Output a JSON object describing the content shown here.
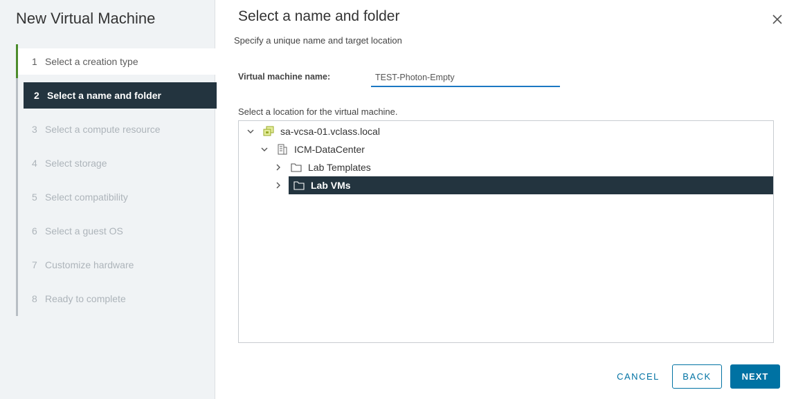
{
  "wizard": {
    "title": "New Virtual Machine",
    "steps": [
      {
        "num": "1",
        "label": "Select a creation type",
        "state": "completed"
      },
      {
        "num": "2",
        "label": "Select a name and folder",
        "state": "active"
      },
      {
        "num": "3",
        "label": "Select a compute resource",
        "state": "disabled"
      },
      {
        "num": "4",
        "label": "Select storage",
        "state": "disabled"
      },
      {
        "num": "5",
        "label": "Select compatibility",
        "state": "disabled"
      },
      {
        "num": "6",
        "label": "Select a guest OS",
        "state": "disabled"
      },
      {
        "num": "7",
        "label": "Customize hardware",
        "state": "disabled"
      },
      {
        "num": "8",
        "label": "Ready to complete",
        "state": "disabled"
      }
    ]
  },
  "page": {
    "title": "Select a name and folder",
    "subtitle": "Specify a unique name and target location",
    "close_icon": "close-icon"
  },
  "form": {
    "name_label": "Virtual machine name:",
    "name_value": "TEST-Photon-Empty",
    "location_label": "Select a location for the virtual machine."
  },
  "tree": {
    "items": [
      {
        "label": "sa-vcsa-01.vclass.local",
        "icon": "vcenter-icon",
        "expanded": true,
        "selected": false
      },
      {
        "label": "ICM-DataCenter",
        "icon": "datacenter-icon",
        "expanded": true,
        "selected": false
      },
      {
        "label": "Lab Templates",
        "icon": "folder-icon",
        "expanded": false,
        "selected": false
      },
      {
        "label": "Lab VMs",
        "icon": "folder-icon",
        "expanded": false,
        "selected": true
      }
    ]
  },
  "footer": {
    "cancel_label": "CANCEL",
    "back_label": "BACK",
    "next_label": "NEXT"
  },
  "colors": {
    "accent": "#0072a3",
    "selected_bg": "#23343f",
    "completed_marker": "#4c8c2b",
    "input_underline": "#1b78c2"
  }
}
